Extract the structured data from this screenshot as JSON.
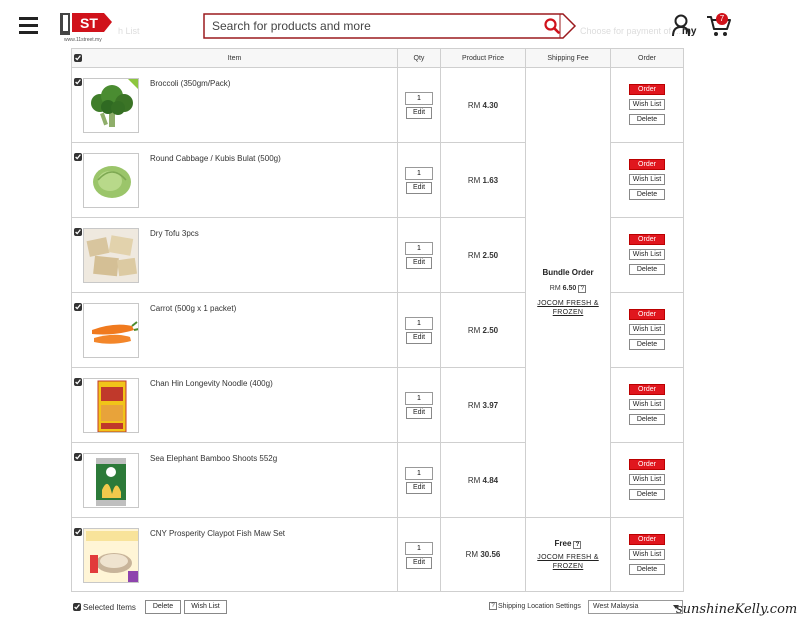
{
  "header": {
    "logo_text": "ST",
    "logo_sub": "www.11street.my",
    "search_placeholder": "Search for products and more",
    "user_label": "my",
    "cart_count": "7",
    "behind_left": "h List",
    "behind_right": "Choose for payment of r..."
  },
  "table": {
    "headers": {
      "item": "Item",
      "qty": "Qty",
      "price": "Product Price",
      "shipping": "Shipping Fee",
      "order": "Order"
    },
    "rows": [
      {
        "name": "Broccoli (350gm/Pack)",
        "qty": "1",
        "currency": "RM",
        "price": "4.30",
        "thumb": "broccoli-image"
      },
      {
        "name": "Round Cabbage / Kubis Bulat (500g)",
        "qty": "1",
        "currency": "RM",
        "price": "1.63",
        "thumb": "cabbage-image"
      },
      {
        "name": "Dry Tofu 3pcs",
        "qty": "1",
        "currency": "RM",
        "price": "2.50",
        "thumb": "tofu-image"
      },
      {
        "name": "Carrot (500g x 1 packet)",
        "qty": "1",
        "currency": "RM",
        "price": "2.50",
        "thumb": "carrot-image"
      },
      {
        "name": "Chan Hin Longevity Noodle (400g)",
        "qty": "1",
        "currency": "RM",
        "price": "3.97",
        "thumb": "noodle-image"
      },
      {
        "name": "Sea Elephant Bamboo Shoots 552g",
        "qty": "1",
        "currency": "RM",
        "price": "4.84",
        "thumb": "bamboo-can-image"
      },
      {
        "name": "CNY Prosperity Claypot Fish Maw Set",
        "qty": "1",
        "currency": "RM",
        "price": "30.56",
        "thumb": "fish-maw-set-image"
      }
    ],
    "bundle": {
      "title": "Bundle Order",
      "currency": "RM",
      "price": "6.50",
      "seller": "JOCOM FRESH & FROZEN"
    },
    "free": {
      "title": "Free",
      "seller": "JOCOM FRESH & FROZEN"
    },
    "labels": {
      "edit": "Edit",
      "order": "Order",
      "wishlist": "Wish List",
      "delete": "Delete",
      "q": "?"
    }
  },
  "footer": {
    "selected_label": "Selected Items",
    "delete": "Delete",
    "wishlist": "Wish List",
    "shipping_label": "Shipping Location Settings",
    "location": "West Malaysia"
  },
  "watermark": "sunshineKelly.com",
  "colors": {
    "brand_red": "#d0121b",
    "order_button": "#e0161e",
    "border": "#cfcfcf"
  }
}
